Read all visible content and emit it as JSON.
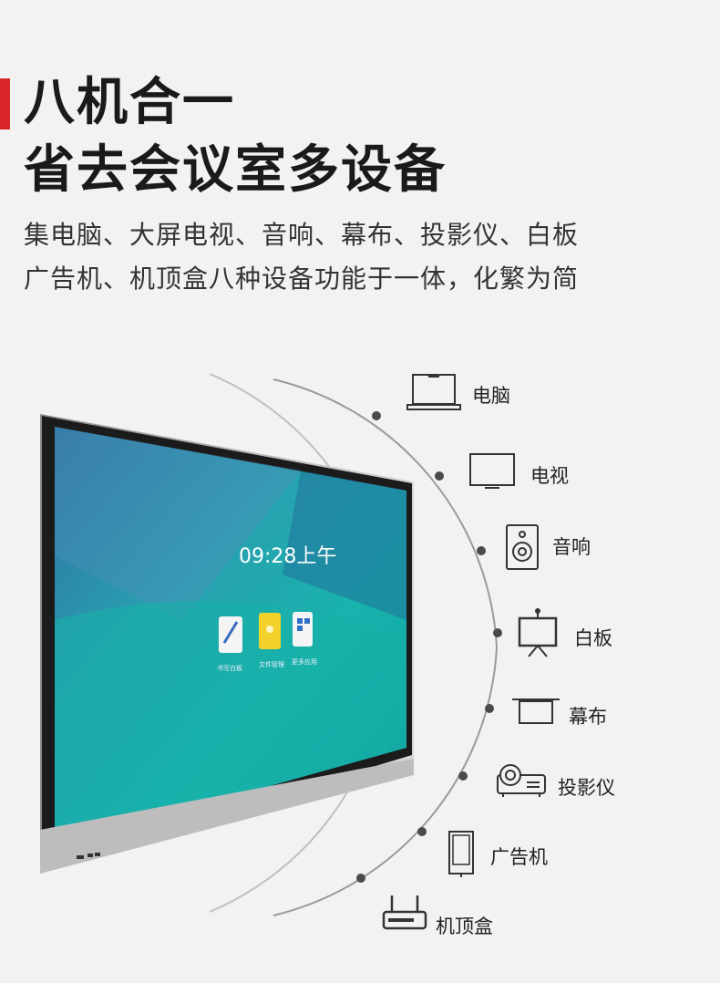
{
  "headline": {
    "line1": "八机合一",
    "line2": "省去会议室多设备"
  },
  "subtitle": {
    "line1": "集电脑、大屏电视、音响、幕布、投影仪、白板",
    "line2": "广告机、机顶盒八种设备功能于一体，化繁为简"
  },
  "screen": {
    "time": "09:28上午",
    "apps": [
      {
        "label": "书写白板",
        "icon": "pen-icon"
      },
      {
        "label": "文件管理",
        "icon": "folder-icon"
      },
      {
        "label": "更多应用",
        "icon": "apps-icon"
      }
    ]
  },
  "devices": [
    {
      "label": "电脑",
      "icon": "laptop-icon"
    },
    {
      "label": "电视",
      "icon": "tv-icon"
    },
    {
      "label": "音响",
      "icon": "speaker-icon"
    },
    {
      "label": "白板",
      "icon": "whiteboard-icon"
    },
    {
      "label": "幕布",
      "icon": "screen-icon"
    },
    {
      "label": "投影仪",
      "icon": "projector-icon"
    },
    {
      "label": "广告机",
      "icon": "ad-machine-icon"
    },
    {
      "label": "机顶盒",
      "icon": "set-top-box-icon"
    }
  ],
  "colors": {
    "accent": "#d8262b",
    "background": "#f2f2f2",
    "screen_teal": "#1aa8a8"
  }
}
